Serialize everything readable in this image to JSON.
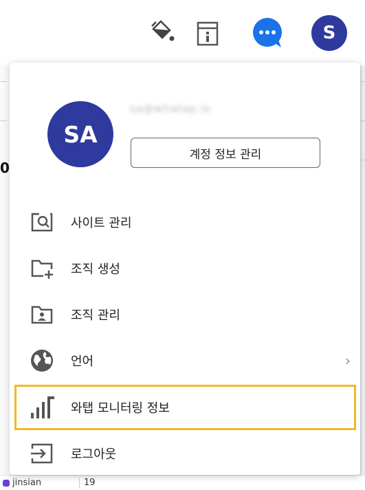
{
  "toolbar": {
    "icons": [
      "paint-bucket-icon",
      "notice-icon",
      "chat-icon"
    ],
    "avatar_initial": "S",
    "colors": {
      "chat": "#1a73e8",
      "avatar": "#2f3a9e"
    }
  },
  "account": {
    "initials": "SA",
    "email": "sa@whatap.io",
    "manage_label": "계정 정보 관리"
  },
  "menu": {
    "items": [
      {
        "label": "사이트 관리",
        "icon": "site-search-icon"
      },
      {
        "label": "조직 생성",
        "icon": "folder-add-icon"
      },
      {
        "label": "조직 관리",
        "icon": "folder-person-icon"
      },
      {
        "label": "언어",
        "icon": "globe-icon",
        "submenu": true
      },
      {
        "label": "와탭 모니터링 정보",
        "icon": "bar-chart-icon",
        "highlighted": true
      },
      {
        "label": "로그아웃",
        "icon": "logout-icon"
      }
    ],
    "highlight_color": "#f5b728"
  },
  "background": {
    "digit": "0",
    "row_text": "jinsian",
    "row_number": "19"
  }
}
